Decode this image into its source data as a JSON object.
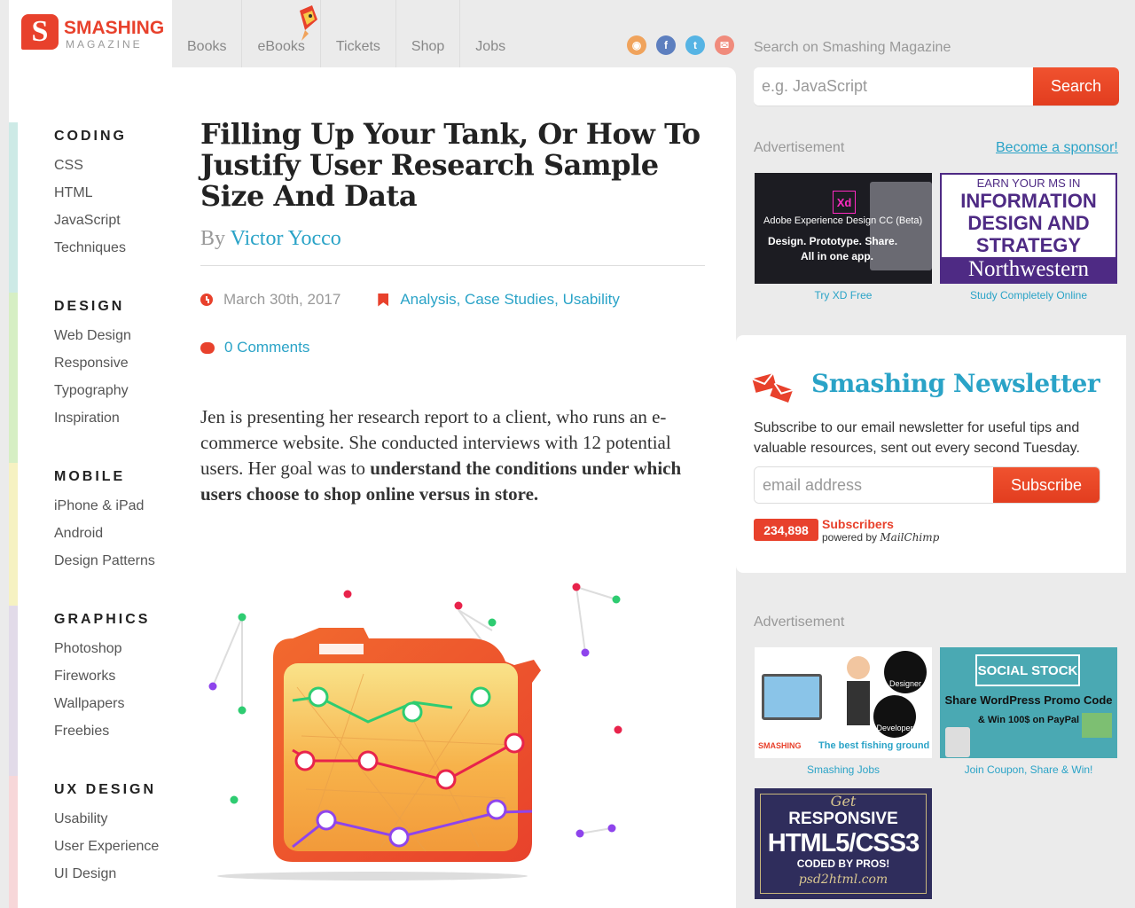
{
  "logo": {
    "mark": "S",
    "name": "SMASHING",
    "sub": "MAGAZINE"
  },
  "topnav": [
    "Books",
    "eBooks",
    "Tickets",
    "Shop",
    "Jobs"
  ],
  "social": [
    {
      "icon": "rss-icon",
      "glyph": "◉",
      "color": "#f0a35c"
    },
    {
      "icon": "facebook-icon",
      "glyph": "f",
      "color": "#5d7fbf"
    },
    {
      "icon": "twitter-icon",
      "glyph": "t",
      "color": "#56b4e4"
    },
    {
      "icon": "email-icon",
      "glyph": "✉",
      "color": "#f08b7c"
    }
  ],
  "sidebar": {
    "categories": [
      {
        "title": "CODING",
        "color": "#cdeae6",
        "links": [
          "CSS",
          "HTML",
          "JavaScript",
          "Techniques"
        ]
      },
      {
        "title": "DESIGN",
        "color": "#d6efc4",
        "links": [
          "Web Design",
          "Responsive",
          "Typography",
          "Inspiration"
        ]
      },
      {
        "title": "MOBILE",
        "color": "#f6f2c2",
        "links": [
          "iPhone & iPad",
          "Android",
          "Design Patterns"
        ]
      },
      {
        "title": "GRAPHICS",
        "color": "#e2dbe9",
        "links": [
          "Photoshop",
          "Fireworks",
          "Wallpapers",
          "Freebies"
        ]
      },
      {
        "title": "UX DESIGN",
        "color": "#f7d7d9",
        "links": [
          "Usability",
          "User Experience",
          "UI Design"
        ]
      }
    ]
  },
  "article": {
    "title": "Filling Up Your Tank, Or How To Justify User Research Sample Size And Data",
    "by": "By",
    "author": "Victor Yocco",
    "date": "March 30th, 2017",
    "tags": "Analysis, Case Studies, Usability",
    "comments": "0 Comments",
    "intro_plain": "Jen is presenting her research report to a client, who runs an e-commerce website. She conducted interviews with 12 potential users. Her goal was to ",
    "intro_bold": "understand the conditions under which users choose to shop online versus in store."
  },
  "search": {
    "label": "Search on Smashing Magazine",
    "placeholder": "e.g. JavaScript",
    "button": "Search"
  },
  "ads_top": {
    "label": "Advertisement",
    "sponsor": "Become a sponsor!",
    "ad1": {
      "badge": "Xd",
      "line1": "Adobe Experience Design CC (Beta)",
      "line2": "Design. Prototype. Share.",
      "line3": "All in one app.",
      "caption": "Try XD Free"
    },
    "ad2": {
      "line1": "EARN YOUR MS IN",
      "line2": "INFORMATION",
      "line3": "DESIGN AND",
      "line4": "STRATEGY",
      "line5": "Northwestern",
      "caption": "Study Completely Online"
    }
  },
  "newsletter": {
    "title": "Smashing Newsletter",
    "text": "Subscribe to our email newsletter for useful tips and valuable resources, sent out every second Tuesday.",
    "placeholder": "email address",
    "button": "Subscribe",
    "count": "234,898",
    "count_label": "Subscribers",
    "powered": "powered by",
    "mailchimp": "MailChimp"
  },
  "ads_bottom": {
    "label": "Advertisement",
    "ad1": {
      "badge1": "Designer",
      "badge2": "Developer",
      "tagline": "The best fishing ground",
      "brand": "SMASHING",
      "caption": "Smashing Jobs"
    },
    "ad2": {
      "title": "SOCIAL STOCK",
      "line1": "Share WordPress Promo Code",
      "line2": "& Win 100$ on PayPal",
      "caption": "Join Coupon, Share & Win!"
    },
    "ad3": {
      "line1": "Get",
      "line2": "RESPONSIVE",
      "line3": "HTML5/CSS3",
      "line4": "CODED BY PROS!",
      "line5": "psd2html.com"
    }
  }
}
